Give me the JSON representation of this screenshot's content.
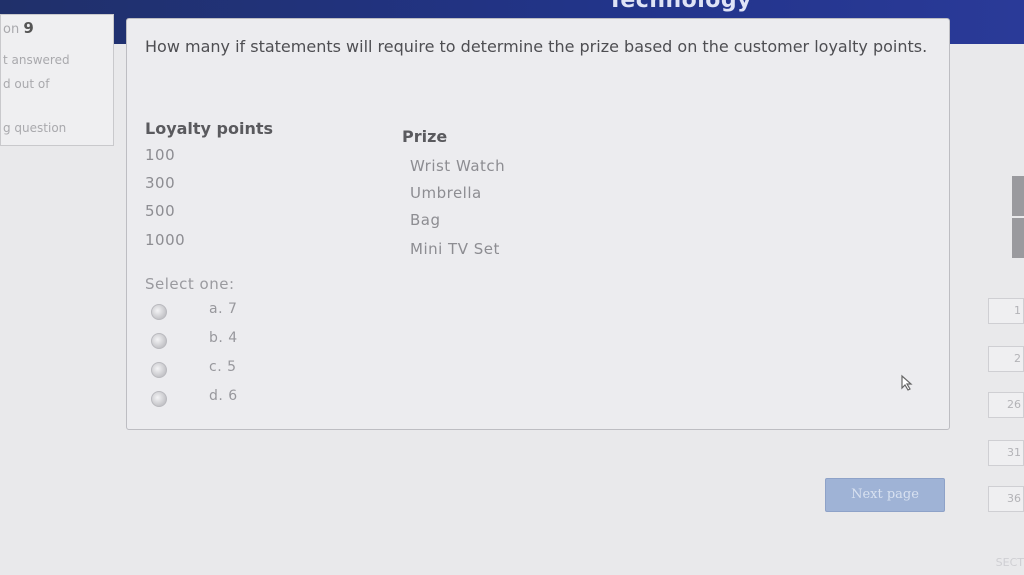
{
  "header": {
    "title": "Technology"
  },
  "question_info": {
    "question_prefix": "on",
    "question_number": "9",
    "state": "t answered",
    "mark": "d out of",
    "flag": "g question"
  },
  "question": {
    "text": "How many if statements will require to determine the prize based on the customer loyalty points.",
    "table": {
      "headers": [
        "Loyalty points",
        "Prize"
      ],
      "rows": [
        {
          "points": "100",
          "prize": "Wrist Watch"
        },
        {
          "points": "300",
          "prize": "Umbrella"
        },
        {
          "points": "500",
          "prize": "Bag"
        },
        {
          "points": "1000",
          "prize": "Mini TV Set"
        }
      ]
    },
    "select_label": "Select one:",
    "options": [
      "a. 7",
      "b. 4",
      "c. 5",
      "d. 6"
    ]
  },
  "footer": {
    "next_label": "Next page"
  },
  "navigation": {
    "items": [
      "1",
      "2",
      "26",
      "31",
      "36"
    ],
    "section_label": "SECT"
  }
}
